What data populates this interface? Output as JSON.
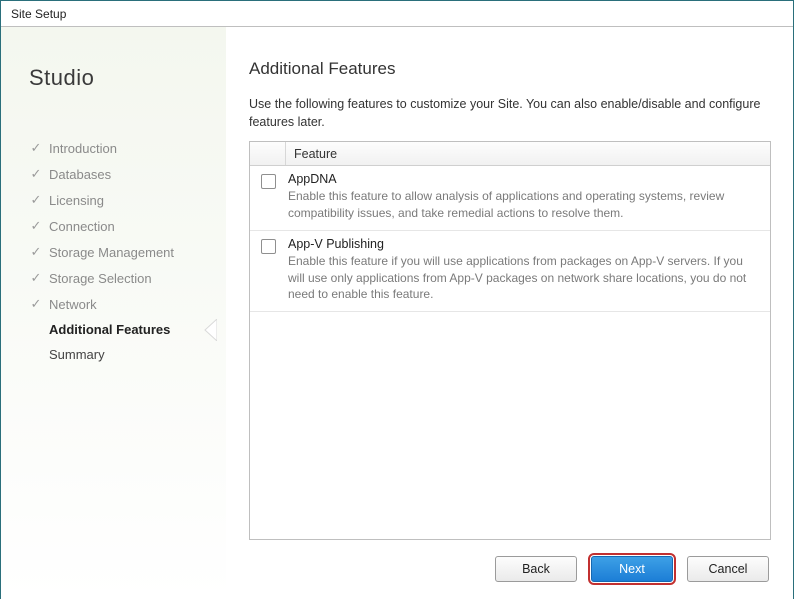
{
  "window": {
    "title": "Site Setup"
  },
  "brand": "Studio",
  "sidebar": {
    "items": [
      {
        "label": "Introduction",
        "state": "done"
      },
      {
        "label": "Databases",
        "state": "done"
      },
      {
        "label": "Licensing",
        "state": "done"
      },
      {
        "label": "Connection",
        "state": "done"
      },
      {
        "label": "Storage Management",
        "state": "done"
      },
      {
        "label": "Storage Selection",
        "state": "done"
      },
      {
        "label": "Network",
        "state": "done"
      },
      {
        "label": "Additional Features",
        "state": "current"
      },
      {
        "label": "Summary",
        "state": "future"
      }
    ]
  },
  "page": {
    "title": "Additional Features",
    "intro": "Use the following features to customize your Site.  You can also enable/disable and configure features later."
  },
  "grid": {
    "header": {
      "feature": "Feature"
    }
  },
  "features": [
    {
      "name": "AppDNA",
      "checked": false,
      "description": "Enable this feature to allow analysis of applications and operating systems, review compatibility issues, and take remedial actions to resolve them."
    },
    {
      "name": "App-V Publishing",
      "checked": false,
      "description": "Enable this feature if you will use applications from packages on App-V servers. If you will use only applications from App-V packages on network share locations, you do not need to enable this feature."
    }
  ],
  "buttons": {
    "back": "Back",
    "next": "Next",
    "cancel": "Cancel"
  }
}
